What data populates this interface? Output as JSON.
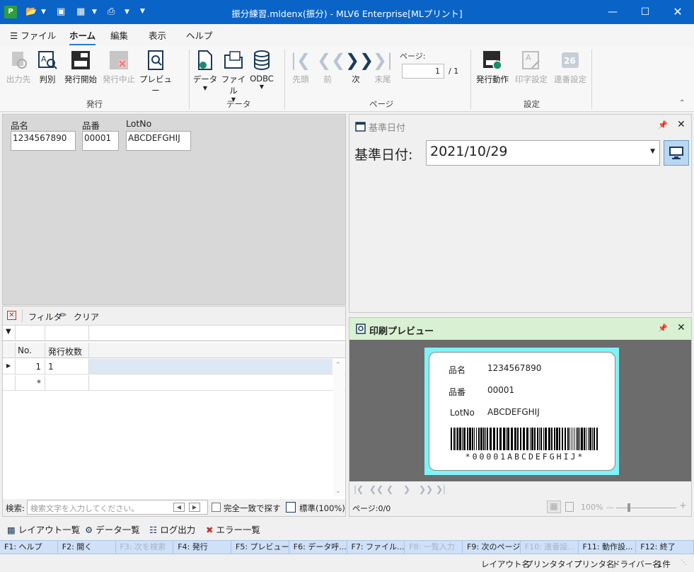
{
  "window": {
    "title": "振分練習.mldenx(振分) - MLV6 Enterprise[MLプリント]",
    "app_icon": "P"
  },
  "menu": {
    "file": "ファイル",
    "home": "ホーム",
    "edit": "編集",
    "view": "表示",
    "help": "ヘルプ"
  },
  "ribbon": {
    "hakko": {
      "group_label": "発行",
      "output": "出力先",
      "judge": "判別",
      "start": "発行開始",
      "stop": "発行中止",
      "preview": "プレビュー"
    },
    "data": {
      "group_label": "データ",
      "data": "データ",
      "file": "ファイル",
      "odbc": "ODBC"
    },
    "page": {
      "group_label": "ページ",
      "first": "先頭",
      "prev": "前",
      "next": "次",
      "last": "末尾",
      "page_label": "ページ:",
      "current": "1",
      "total": "/ 1"
    },
    "settings": {
      "group_label": "設定",
      "action": "発行動作",
      "print_settings": "印字設定",
      "serial_settings": "連番設定"
    }
  },
  "input_panel": {
    "fields": [
      {
        "label": "品名",
        "value": "1234567890"
      },
      {
        "label": "品番",
        "value": "00001"
      },
      {
        "label": "LotNo",
        "value": "ABCDEFGHIJ"
      }
    ]
  },
  "date_panel": {
    "title": "基準日付",
    "label": "基準日付:",
    "value": "2021/10/29"
  },
  "list_panel": {
    "filter": "フィルタ",
    "clear": "クリア",
    "col_no": "No.",
    "col_count": "発行枚数",
    "rows": [
      {
        "no": "1",
        "count": "1"
      },
      {
        "no": "*",
        "count": ""
      }
    ],
    "search_label": "検索:",
    "search_placeholder": "検索文字を入力してください。",
    "exact_match": "完全一致で探す",
    "standard": "標準(100%)"
  },
  "preview_panel": {
    "title": "印刷プレビュー",
    "label_rows": [
      {
        "key": "品名",
        "value": "1234567890"
      },
      {
        "key": "品番",
        "value": "00001"
      },
      {
        "key": "LotNo",
        "value": "ABCDEFGHIJ"
      }
    ],
    "barcode_text": "*00001ABCDEFGHIJ*",
    "page_status": "ページ:0/0",
    "zoom": "100%"
  },
  "bottom_tabs": [
    "レイアウト一覧",
    "データ一覧",
    "ログ出力",
    "エラー一覧"
  ],
  "fkeys": [
    {
      "label": "F1: ヘルプ",
      "enabled": true
    },
    {
      "label": "F2: 開く",
      "enabled": true
    },
    {
      "label": "F3: 次を検索",
      "enabled": false
    },
    {
      "label": "F4: 発行",
      "enabled": true
    },
    {
      "label": "F5: プレビュー",
      "enabled": true
    },
    {
      "label": "F6: データ呼...",
      "enabled": true
    },
    {
      "label": "F7: ファイル...",
      "enabled": true
    },
    {
      "label": "F8: 一覧入力",
      "enabled": false
    },
    {
      "label": "F9: 次のページ",
      "enabled": true
    },
    {
      "label": "F10: 連番設...",
      "enabled": false
    },
    {
      "label": "F11: 動作設...",
      "enabled": true
    },
    {
      "label": "F12: 終了",
      "enabled": true
    }
  ],
  "status": {
    "layout_name": "レイアウト名",
    "printer_type": "プリンタタイプ",
    "printer_name": "プリンタ名",
    "driver_name": "ドライバー名",
    "count": "1件"
  },
  "colors": {
    "titlebar": "#0a64c8",
    "accent": "#2b79d6",
    "preview_header": "#d9f0d3",
    "label_border": "#7ff3f7"
  }
}
